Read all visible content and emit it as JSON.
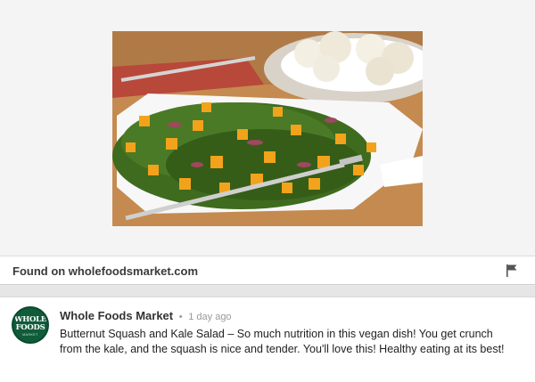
{
  "pin": {
    "image_alt": "Butternut squash and kale salad on a white platter",
    "image_colors": {
      "board": "#c58a4f",
      "kale": "#3f6b1f",
      "squash": "#f3a21b",
      "plate": "#ffffff",
      "onion": "#a0485e"
    }
  },
  "source": {
    "label": "Found on wholefoodsmarket.com",
    "flag_icon": "flag-icon"
  },
  "comment": {
    "avatar": {
      "brand_line1": "WHOLE",
      "brand_line2": "FOODS",
      "brand_sub": "MARKET"
    },
    "author": "Whole Foods Market",
    "separator": "•",
    "time": "1 day ago",
    "text": "Butternut Squash and Kale Salad – So much nutrition in this vegan dish! You get crunch from the kale, and the squash is nice and tender. You'll love this! Healthy eating at its best!"
  }
}
